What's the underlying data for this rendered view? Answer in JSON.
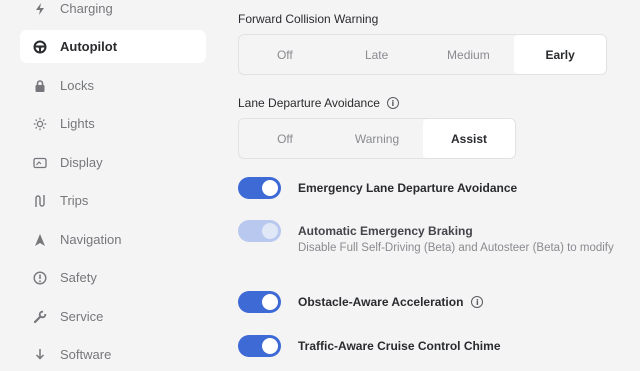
{
  "sidebar": {
    "items": [
      {
        "label": "Charging",
        "icon": "lightning-icon",
        "active": false
      },
      {
        "label": "Autopilot",
        "icon": "steering-wheel-icon",
        "active": true
      },
      {
        "label": "Locks",
        "icon": "lock-icon",
        "active": false
      },
      {
        "label": "Lights",
        "icon": "sun-icon",
        "active": false
      },
      {
        "label": "Display",
        "icon": "display-icon",
        "active": false
      },
      {
        "label": "Trips",
        "icon": "route-icon",
        "active": false
      },
      {
        "label": "Navigation",
        "icon": "navigation-arrow-icon",
        "active": false
      },
      {
        "label": "Safety",
        "icon": "alert-circle-icon",
        "active": false
      },
      {
        "label": "Service",
        "icon": "wrench-icon",
        "active": false
      },
      {
        "label": "Software",
        "icon": "download-icon",
        "active": false
      }
    ]
  },
  "collision_warning": {
    "title": "Forward Collision Warning",
    "options": [
      "Off",
      "Late",
      "Medium",
      "Early"
    ],
    "selected": "Early"
  },
  "lane_departure": {
    "title": "Lane Departure Avoidance",
    "info_glyph": "i",
    "options": [
      "Off",
      "Warning",
      "Assist"
    ],
    "selected": "Assist"
  },
  "toggles": [
    {
      "label": "Emergency Lane Departure Avoidance",
      "enabled": true,
      "disabled": false
    },
    {
      "label": "Automatic Emergency Braking",
      "enabled": true,
      "disabled": true,
      "sub": "Disable Full Self-Driving (Beta) and Autosteer (Beta) to modify"
    },
    {
      "label": "Obstacle-Aware Acceleration",
      "enabled": true,
      "disabled": false,
      "info_glyph": "i"
    },
    {
      "label": "Traffic-Aware Cruise Control Chime",
      "enabled": true,
      "disabled": false
    }
  ],
  "colors": {
    "accent": "#3e6ad6",
    "background": "#f4f4f5",
    "active_bg": "#ffffff"
  }
}
